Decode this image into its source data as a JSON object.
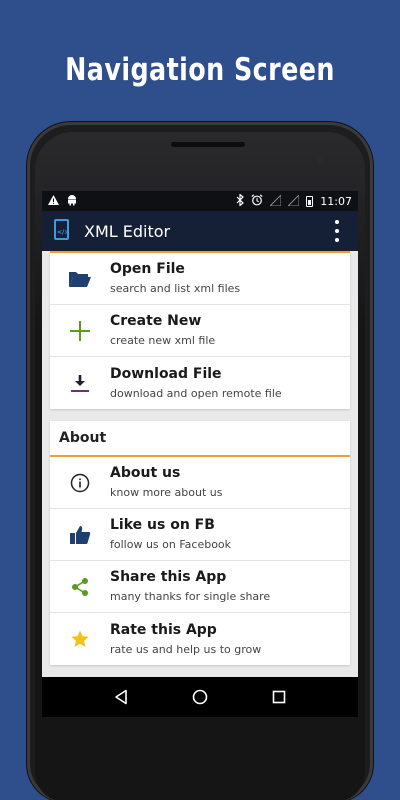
{
  "promo": {
    "title": "Navigation Screen"
  },
  "status_bar": {
    "left_icons": [
      "warning-icon",
      "android-icon"
    ],
    "right_icons": [
      "bluetooth-icon",
      "alarm-icon",
      "signal-icon",
      "signal-icon",
      "battery-icon"
    ],
    "time": "11:07"
  },
  "app_bar": {
    "title": "XML Editor",
    "menu_icon": "overflow-menu-icon"
  },
  "file_items": [
    {
      "title": "Open File",
      "subtitle": "search and list xml files",
      "icon": "folder-open-icon"
    },
    {
      "title": "Create New",
      "subtitle": "create new xml file",
      "icon": "plus-icon"
    },
    {
      "title": "Download File",
      "subtitle": "download and open remote file",
      "icon": "download-icon"
    }
  ],
  "about_section": {
    "header": "About",
    "items": [
      {
        "title": "About us",
        "subtitle": "know more about us",
        "icon": "info-icon"
      },
      {
        "title": "Like us on FB",
        "subtitle": "follow us on Facebook",
        "icon": "thumbs-up-icon"
      },
      {
        "title": "Share this App",
        "subtitle": "many thanks for single share",
        "icon": "share-icon"
      },
      {
        "title": "Rate this App",
        "subtitle": "rate us and help us to grow",
        "icon": "star-icon"
      }
    ]
  },
  "nav_bar": {
    "icons": [
      "back-icon",
      "home-icon",
      "recents-icon"
    ]
  },
  "colors": {
    "background": "#2f4e8c",
    "app_bar": "#152036",
    "accent": "#f0a030",
    "icon_blue": "#1f3f6e",
    "icon_green": "#5b9a1f",
    "icon_star": "#f3c21b"
  }
}
